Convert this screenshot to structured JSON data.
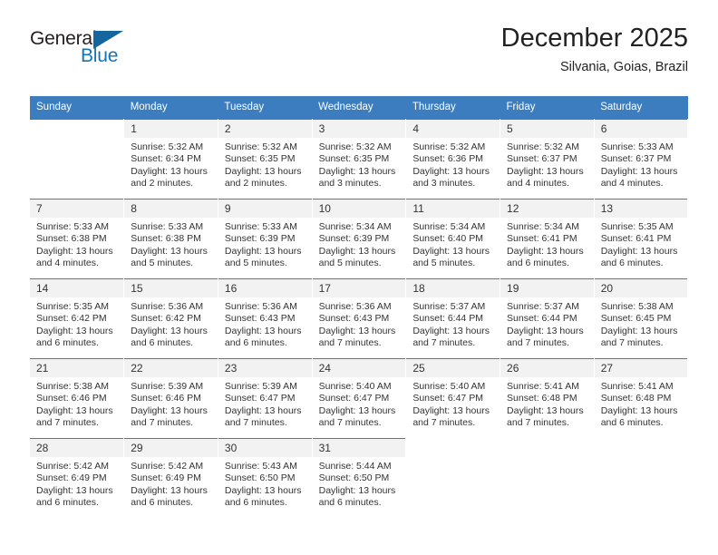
{
  "brand": {
    "name_part1": "General",
    "name_part2": "Blue",
    "triangle_icon": "triangle-icon",
    "primary_color": "#1373ba",
    "triangle_color": "#15659f",
    "text_color": "#231f20"
  },
  "header": {
    "month_title": "December 2025",
    "location": "Silvania, Goias, Brazil"
  },
  "calendar": {
    "header_color": "#3b7dbf",
    "daynum_background": "#f2f2f2",
    "weekday_headers": [
      "Sunday",
      "Monday",
      "Tuesday",
      "Wednesday",
      "Thursday",
      "Friday",
      "Saturday"
    ],
    "weeks": [
      [
        {
          "day": "",
          "sunrise": "",
          "sunset": "",
          "daylight": "",
          "empty": true
        },
        {
          "day": "1",
          "sunrise": "Sunrise: 5:32 AM",
          "sunset": "Sunset: 6:34 PM",
          "daylight": "Daylight: 13 hours and 2 minutes."
        },
        {
          "day": "2",
          "sunrise": "Sunrise: 5:32 AM",
          "sunset": "Sunset: 6:35 PM",
          "daylight": "Daylight: 13 hours and 2 minutes."
        },
        {
          "day": "3",
          "sunrise": "Sunrise: 5:32 AM",
          "sunset": "Sunset: 6:35 PM",
          "daylight": "Daylight: 13 hours and 3 minutes."
        },
        {
          "day": "4",
          "sunrise": "Sunrise: 5:32 AM",
          "sunset": "Sunset: 6:36 PM",
          "daylight": "Daylight: 13 hours and 3 minutes."
        },
        {
          "day": "5",
          "sunrise": "Sunrise: 5:32 AM",
          "sunset": "Sunset: 6:37 PM",
          "daylight": "Daylight: 13 hours and 4 minutes."
        },
        {
          "day": "6",
          "sunrise": "Sunrise: 5:33 AM",
          "sunset": "Sunset: 6:37 PM",
          "daylight": "Daylight: 13 hours and 4 minutes."
        }
      ],
      [
        {
          "day": "7",
          "sunrise": "Sunrise: 5:33 AM",
          "sunset": "Sunset: 6:38 PM",
          "daylight": "Daylight: 13 hours and 4 minutes."
        },
        {
          "day": "8",
          "sunrise": "Sunrise: 5:33 AM",
          "sunset": "Sunset: 6:38 PM",
          "daylight": "Daylight: 13 hours and 5 minutes."
        },
        {
          "day": "9",
          "sunrise": "Sunrise: 5:33 AM",
          "sunset": "Sunset: 6:39 PM",
          "daylight": "Daylight: 13 hours and 5 minutes."
        },
        {
          "day": "10",
          "sunrise": "Sunrise: 5:34 AM",
          "sunset": "Sunset: 6:39 PM",
          "daylight": "Daylight: 13 hours and 5 minutes."
        },
        {
          "day": "11",
          "sunrise": "Sunrise: 5:34 AM",
          "sunset": "Sunset: 6:40 PM",
          "daylight": "Daylight: 13 hours and 5 minutes."
        },
        {
          "day": "12",
          "sunrise": "Sunrise: 5:34 AM",
          "sunset": "Sunset: 6:41 PM",
          "daylight": "Daylight: 13 hours and 6 minutes."
        },
        {
          "day": "13",
          "sunrise": "Sunrise: 5:35 AM",
          "sunset": "Sunset: 6:41 PM",
          "daylight": "Daylight: 13 hours and 6 minutes."
        }
      ],
      [
        {
          "day": "14",
          "sunrise": "Sunrise: 5:35 AM",
          "sunset": "Sunset: 6:42 PM",
          "daylight": "Daylight: 13 hours and 6 minutes."
        },
        {
          "day": "15",
          "sunrise": "Sunrise: 5:36 AM",
          "sunset": "Sunset: 6:42 PM",
          "daylight": "Daylight: 13 hours and 6 minutes."
        },
        {
          "day": "16",
          "sunrise": "Sunrise: 5:36 AM",
          "sunset": "Sunset: 6:43 PM",
          "daylight": "Daylight: 13 hours and 6 minutes."
        },
        {
          "day": "17",
          "sunrise": "Sunrise: 5:36 AM",
          "sunset": "Sunset: 6:43 PM",
          "daylight": "Daylight: 13 hours and 7 minutes."
        },
        {
          "day": "18",
          "sunrise": "Sunrise: 5:37 AM",
          "sunset": "Sunset: 6:44 PM",
          "daylight": "Daylight: 13 hours and 7 minutes."
        },
        {
          "day": "19",
          "sunrise": "Sunrise: 5:37 AM",
          "sunset": "Sunset: 6:44 PM",
          "daylight": "Daylight: 13 hours and 7 minutes."
        },
        {
          "day": "20",
          "sunrise": "Sunrise: 5:38 AM",
          "sunset": "Sunset: 6:45 PM",
          "daylight": "Daylight: 13 hours and 7 minutes."
        }
      ],
      [
        {
          "day": "21",
          "sunrise": "Sunrise: 5:38 AM",
          "sunset": "Sunset: 6:46 PM",
          "daylight": "Daylight: 13 hours and 7 minutes."
        },
        {
          "day": "22",
          "sunrise": "Sunrise: 5:39 AM",
          "sunset": "Sunset: 6:46 PM",
          "daylight": "Daylight: 13 hours and 7 minutes."
        },
        {
          "day": "23",
          "sunrise": "Sunrise: 5:39 AM",
          "sunset": "Sunset: 6:47 PM",
          "daylight": "Daylight: 13 hours and 7 minutes."
        },
        {
          "day": "24",
          "sunrise": "Sunrise: 5:40 AM",
          "sunset": "Sunset: 6:47 PM",
          "daylight": "Daylight: 13 hours and 7 minutes."
        },
        {
          "day": "25",
          "sunrise": "Sunrise: 5:40 AM",
          "sunset": "Sunset: 6:47 PM",
          "daylight": "Daylight: 13 hours and 7 minutes."
        },
        {
          "day": "26",
          "sunrise": "Sunrise: 5:41 AM",
          "sunset": "Sunset: 6:48 PM",
          "daylight": "Daylight: 13 hours and 7 minutes."
        },
        {
          "day": "27",
          "sunrise": "Sunrise: 5:41 AM",
          "sunset": "Sunset: 6:48 PM",
          "daylight": "Daylight: 13 hours and 6 minutes."
        }
      ],
      [
        {
          "day": "28",
          "sunrise": "Sunrise: 5:42 AM",
          "sunset": "Sunset: 6:49 PM",
          "daylight": "Daylight: 13 hours and 6 minutes."
        },
        {
          "day": "29",
          "sunrise": "Sunrise: 5:42 AM",
          "sunset": "Sunset: 6:49 PM",
          "daylight": "Daylight: 13 hours and 6 minutes."
        },
        {
          "day": "30",
          "sunrise": "Sunrise: 5:43 AM",
          "sunset": "Sunset: 6:50 PM",
          "daylight": "Daylight: 13 hours and 6 minutes."
        },
        {
          "day": "31",
          "sunrise": "Sunrise: 5:44 AM",
          "sunset": "Sunset: 6:50 PM",
          "daylight": "Daylight: 13 hours and 6 minutes."
        },
        {
          "day": "",
          "sunrise": "",
          "sunset": "",
          "daylight": "",
          "empty": true
        },
        {
          "day": "",
          "sunrise": "",
          "sunset": "",
          "daylight": "",
          "empty": true
        },
        {
          "day": "",
          "sunrise": "",
          "sunset": "",
          "daylight": "",
          "empty": true
        }
      ]
    ]
  }
}
